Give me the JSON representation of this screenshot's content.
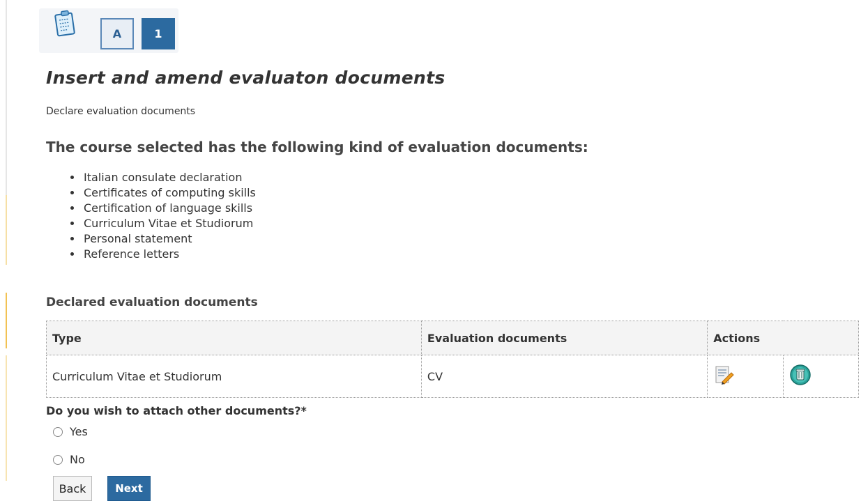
{
  "steps": {
    "items": [
      "A",
      "1"
    ],
    "icon": "clipboard-icon"
  },
  "page": {
    "title": "Insert and amend evaluaton documents",
    "subtitle": "Declare evaluation documents",
    "heading": "The course selected has the following kind of evaluation documents:"
  },
  "document_types": [
    "Italian consulate declaration",
    "Certificates of computing skills",
    "Certification of language skills",
    "Curriculum Vitae et Studiorum",
    "Personal statement",
    "Reference letters"
  ],
  "declared": {
    "label": "Declared evaluation documents",
    "columns": [
      "Type",
      "Evaluation documents",
      "Actions"
    ],
    "rows": [
      {
        "type": "Curriculum Vitae et Studiorum",
        "document": "CV",
        "actions": [
          "edit-icon",
          "trash-icon"
        ]
      }
    ]
  },
  "question": {
    "text": "Do you wish to attach other documents?*",
    "options": [
      "Yes",
      "No"
    ],
    "selected": null
  },
  "buttons": {
    "back": "Back",
    "next": "Next"
  },
  "colors": {
    "accent": "#2c6aa0",
    "step_inactive_border": "#5a88b8"
  }
}
